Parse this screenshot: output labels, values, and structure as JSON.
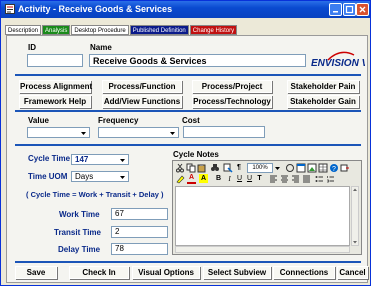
{
  "window": {
    "title": "Activity - Receive Goods & Services"
  },
  "tabs": [
    {
      "label": "Description",
      "bg": "#ffffff",
      "fg": "#000000"
    },
    {
      "label": "Analysis",
      "bg": "#1a8a1a",
      "fg": "#ffffff"
    },
    {
      "label": "Desktop Procedure",
      "bg": "#ffffff",
      "fg": "#000000"
    },
    {
      "label": "Published Definition",
      "bg": "#0a1a8a",
      "fg": "#ffffff"
    },
    {
      "label": "Change History",
      "bg": "#c01010",
      "fg": "#ffffff"
    }
  ],
  "header": {
    "id_label": "ID",
    "id_value": "",
    "name_label": "Name",
    "name_value": "Receive Goods & Services",
    "logo": "ENVISION VIP"
  },
  "links": [
    "Process Alignment",
    "Process/Function",
    "Process/Project",
    "Stakeholder Pain",
    "Framework Help",
    "Add/View Functions",
    "Process/Technology",
    "Stakeholder Gain"
  ],
  "value_section": {
    "value_label": "Value",
    "frequency_label": "Frequency",
    "cost_label": "Cost",
    "value": "",
    "frequency": "",
    "cost": ""
  },
  "cycle": {
    "cycle_time_label": "Cycle Time",
    "cycle_time_value": "147",
    "uom_label": "Time UOM",
    "uom_value": "Days",
    "formula": "( Cycle Time  =  Work + Transit + Delay )",
    "work_label": "Work Time",
    "work_value": "67",
    "transit_label": "Transit Time",
    "transit_value": "2",
    "delay_label": "Delay Time",
    "delay_value": "78",
    "notes_label": "Cycle Notes",
    "zoom": "100%"
  },
  "footer": [
    "Save",
    "Check In",
    "Visual Options",
    "Select Subview",
    "Connections",
    "Cancel"
  ],
  "colors": {
    "title_bar": "#0a4ad0",
    "separator": "#1b55b8",
    "label_blue": "#0a2a8a"
  }
}
